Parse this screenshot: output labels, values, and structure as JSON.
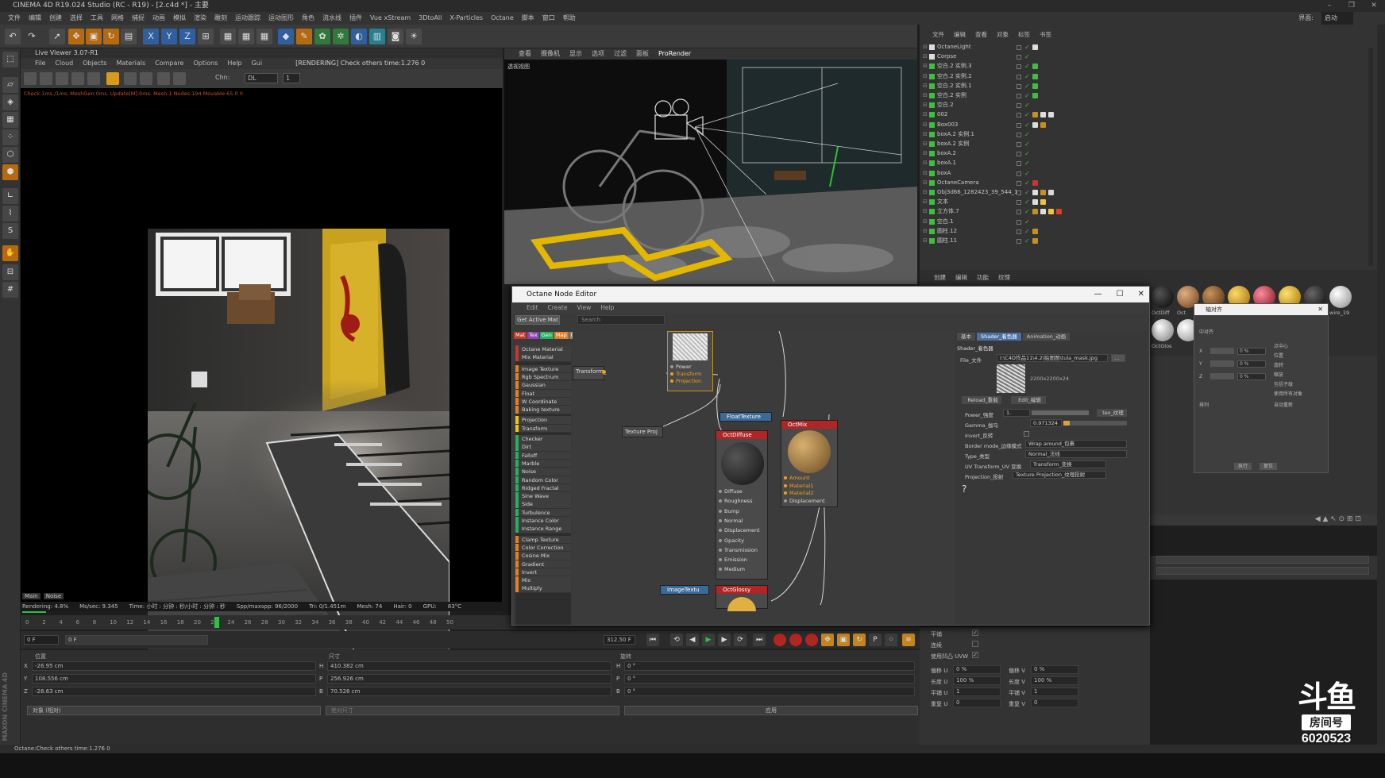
{
  "window": {
    "title": "CINEMA 4D R19.024 Studio (RC - R19) - [2.c4d *] - 主要",
    "layout_label": "界面:",
    "layout_value": "启动"
  },
  "menubar": {
    "items": [
      "文件",
      "编辑",
      "创建",
      "选择",
      "工具",
      "网格",
      "捕捉",
      "动画",
      "模拟",
      "渲染",
      "雕刻",
      "运动跟踪",
      "运动图形",
      "角色",
      "流水线",
      "插件",
      "Vue xStream",
      "3DtoAll",
      "X-Particles",
      "Octane",
      "脚本",
      "窗口",
      "帮助"
    ]
  },
  "live_viewer": {
    "title": "Live Viewer 3.07-R1",
    "menu": [
      "File",
      "Cloud",
      "Objects",
      "Materials",
      "Compare",
      "Options",
      "Help",
      "Gui"
    ],
    "status": "[RENDERING] Check others time:1.276  0",
    "chn_label": "Chn:",
    "chn_value": "DL",
    "chn_num": "1",
    "info_line": "Check:1ms./1ms. MeshGen:0ms. Update[M]:0ms. Mesh:1 Nodes:194 Movable:65  0 0",
    "tabs": [
      "Main",
      "Noise"
    ],
    "stats": {
      "rendering": "Rendering: 4.8%",
      "ms": "Ms/sec: 9.345",
      "time": "Time: 小时 : 分钟 : 秒/小时 : 分钟 : 秒",
      "spp": "Spp/maxspp: 96/2000",
      "tri": "Tri: 0/1.451m",
      "mesh": "Mesh: 74",
      "hair": "Hair: 0",
      "gpu": "GPU:",
      "temp": "83°C"
    },
    "render_progress": 0.048
  },
  "viewport": {
    "menu": [
      "查看",
      "摄像机",
      "显示",
      "选项",
      "过滤",
      "面板",
      "ProRender"
    ],
    "label": "透视视图"
  },
  "timeline": {
    "ticks": [
      "0",
      "2",
      "4",
      "6",
      "8",
      "10",
      "12",
      "14",
      "16",
      "18",
      "20",
      "22",
      "24",
      "26",
      "28",
      "30",
      "32",
      "34",
      "36",
      "38",
      "40",
      "42",
      "44",
      "46",
      "48",
      "50"
    ],
    "current_frame": "20",
    "start": "0 F",
    "cur": "0 F",
    "end": "90 F",
    "end2": "312.50 F"
  },
  "coords": {
    "headers": [
      "位置",
      "尺寸",
      "旋转"
    ],
    "rows": [
      {
        "axis": "X",
        "pos": "-26.95 cm",
        "size_axis": "H",
        "size": "410.382 cm",
        "rot_axis": "H",
        "rot": "0 °"
      },
      {
        "axis": "Y",
        "pos": "108.556 cm",
        "size_axis": "P",
        "size": "256.926 cm",
        "rot_axis": "P",
        "rot": "0 °"
      },
      {
        "axis": "Z",
        "pos": "-28.63 cm",
        "size_axis": "B",
        "size": "70.526 cm",
        "rot_axis": "B",
        "rot": "0 °"
      }
    ],
    "mode": "对象 (相对)",
    "size_mode": "绝对尺寸",
    "apply": "应用"
  },
  "statusbar": "Octane:Check others time:1.276  0",
  "object_manager": {
    "menu": [
      "文件",
      "编辑",
      "查看",
      "对象",
      "标签",
      "书签"
    ],
    "objects": [
      "OctaneLight",
      "Corpse",
      "空白.2 实例.3",
      "空白.2 实例.2",
      "空白.2 实例.1",
      "空白.2 实例",
      "空白.2",
      "002",
      "Box003",
      "boxA.2 实例.1",
      "boxA.2 实例",
      "boxA.2",
      "boxA.1",
      "boxA",
      "OctaneCamera",
      "Obj3d66_1282423_39_544_1",
      "文本",
      "立方体.7",
      "空白.1",
      "圆柱.12",
      "圆柱.11"
    ]
  },
  "material_manager": {
    "menu": [
      "创建",
      "编辑",
      "功能",
      "纹理"
    ],
    "names": [
      "OctDiff",
      "Oct",
      "Oct",
      "Oct",
      "Oct",
      "Oct",
      "Oct",
      "wire_19",
      "OctGlos"
    ]
  },
  "attributes": {
    "rows": [
      {
        "label": "平铺",
        "checked": true
      },
      {
        "label": "连续",
        "checked": false
      },
      {
        "label": "使用凹凸 UVW",
        "checked": true
      }
    ],
    "fields": [
      {
        "l1": "偏移 U",
        "v1": "0 %",
        "l2": "偏移 V",
        "v2": "0 %"
      },
      {
        "l1": "长度 U",
        "v1": "100 %",
        "l2": "长度 V",
        "v2": "100 %"
      },
      {
        "l1": "平铺 U",
        "v1": "1",
        "l2": "平铺 V",
        "v2": "1"
      },
      {
        "l1": "重复 U",
        "v1": "0",
        "l2": "重复 V",
        "v2": "0"
      }
    ]
  },
  "node_editor": {
    "title": "Octane Node Editor",
    "menu": [
      "Edit",
      "Create",
      "View",
      "Help"
    ],
    "get_active": "Get Active Mat",
    "search": "Search",
    "cat_tabs": [
      {
        "label": "Mat",
        "color": "#c0392b"
      },
      {
        "label": "Tex",
        "color": "#8e44ad"
      },
      {
        "label": "Gen",
        "color": "#27ae60"
      },
      {
        "label": "Map",
        "color": "#e67e22"
      },
      {
        "label": "Oth",
        "color": "#7f8c8d"
      },
      {
        "label": "Emi",
        "color": "#d35400"
      },
      {
        "label": "Med",
        "color": "#2980b9"
      },
      {
        "label": "C4D",
        "color": "#555555"
      }
    ],
    "node_list": [
      {
        "label": "Octane Material",
        "color": "#c0392b"
      },
      {
        "label": "Mix Material",
        "color": "#c0392b"
      },
      {
        "label": "Image Texture",
        "color": "#e67e22"
      },
      {
        "label": "Rgb Spectrum",
        "color": "#e67e22"
      },
      {
        "label": "Gaussian Spectrum",
        "color": "#e67e22"
      },
      {
        "label": "Float",
        "color": "#e67e22"
      },
      {
        "label": "W Coordinate",
        "color": "#e67e22"
      },
      {
        "label": "Baking texture",
        "color": "#e67e22"
      },
      {
        "label": "Projection",
        "color": "#f1c40f"
      },
      {
        "label": "Transform",
        "color": "#f1c40f"
      },
      {
        "label": "Checker",
        "color": "#27ae60"
      },
      {
        "label": "Dirt",
        "color": "#27ae60"
      },
      {
        "label": "Falloff",
        "color": "#27ae60"
      },
      {
        "label": "Marble",
        "color": "#27ae60"
      },
      {
        "label": "Noise",
        "color": "#27ae60"
      },
      {
        "label": "Random Color",
        "color": "#27ae60"
      },
      {
        "label": "Ridged Fractal",
        "color": "#27ae60"
      },
      {
        "label": "Sine Wave",
        "color": "#27ae60"
      },
      {
        "label": "Side",
        "color": "#27ae60"
      },
      {
        "label": "Turbulence",
        "color": "#27ae60"
      },
      {
        "label": "Instance Color",
        "color": "#27ae60"
      },
      {
        "label": "Instance Range",
        "color": "#27ae60"
      },
      {
        "label": "Clamp Texture",
        "color": "#e67e22"
      },
      {
        "label": "Color Correction",
        "color": "#e67e22"
      },
      {
        "label": "Cosine Mix",
        "color": "#e67e22"
      },
      {
        "label": "Gradient",
        "color": "#e67e22"
      },
      {
        "label": "Invert",
        "color": "#e67e22"
      },
      {
        "label": "Mix",
        "color": "#e67e22"
      },
      {
        "label": "Multiply",
        "color": "#e67e22"
      }
    ],
    "nodes": {
      "transform": "Transform_",
      "texture_proj": "Texture Proj",
      "image_pins": [
        "Power",
        "Transform",
        "Projection"
      ],
      "float_texture": "FloatTexture",
      "oct_diffuse": "OctDiffuse",
      "diffuse_pins": [
        "Diffuse",
        "Roughness",
        "Bump",
        "Normal",
        "Displacement",
        "Opacity",
        "Transmission",
        "Emission",
        "Medium"
      ],
      "oct_mix": "OctMix",
      "mix_pins": [
        "Amount",
        "Material1",
        "Material2",
        "Displacement"
      ],
      "image_texture": "ImageTextu",
      "oct_glossy": "OctGlossy"
    },
    "props": {
      "tabs": [
        "基本",
        "Shader_着色器",
        "Animation_动画"
      ],
      "section": "Shader_着色器",
      "file_label": "File_文件",
      "file_value": "I:\\C4D作品11\\4.2\\贴图图\\tula_mask.jpg",
      "resolution": "2200x2200x24",
      "reload": "Reload_重载",
      "edit": "Edit_编辑",
      "power_label": "Power_强度",
      "power_value": "1.",
      "power_btn": "tex_纹理",
      "gamma_label": "Gamma_伽马",
      "gamma_value": "0.971324",
      "invert_label": "Invert_反转",
      "border_label": "Border mode_边缘模式",
      "border_value": "Wrap around_包裹",
      "type_label": "Type_类型",
      "type_value": "Normal_法线",
      "uv_label": "UV Transform_UV 变换",
      "uv_value": "Transform_变换",
      "proj_label": "Projection_投射",
      "proj_value": "Texture Projection_纹理投射",
      "help": "?"
    }
  },
  "float_dialog": {
    "title": "轴对齐",
    "rows": [
      "中对齐",
      "点中心",
      "位置",
      "旋转",
      "缩放",
      "包括子级",
      "使用所有对象",
      "自动重新",
      "排列"
    ],
    "btns": [
      "执行",
      "复位"
    ],
    "axes": [
      {
        "l": "X",
        "v": "0 %"
      },
      {
        "l": "Y",
        "v": "0 %"
      },
      {
        "l": "Z",
        "v": "0 %"
      }
    ]
  },
  "watermark": {
    "logo": "斗鱼",
    "room": "房间号",
    "number": "6020523"
  },
  "brand": "MAXON CINEMA 4D"
}
